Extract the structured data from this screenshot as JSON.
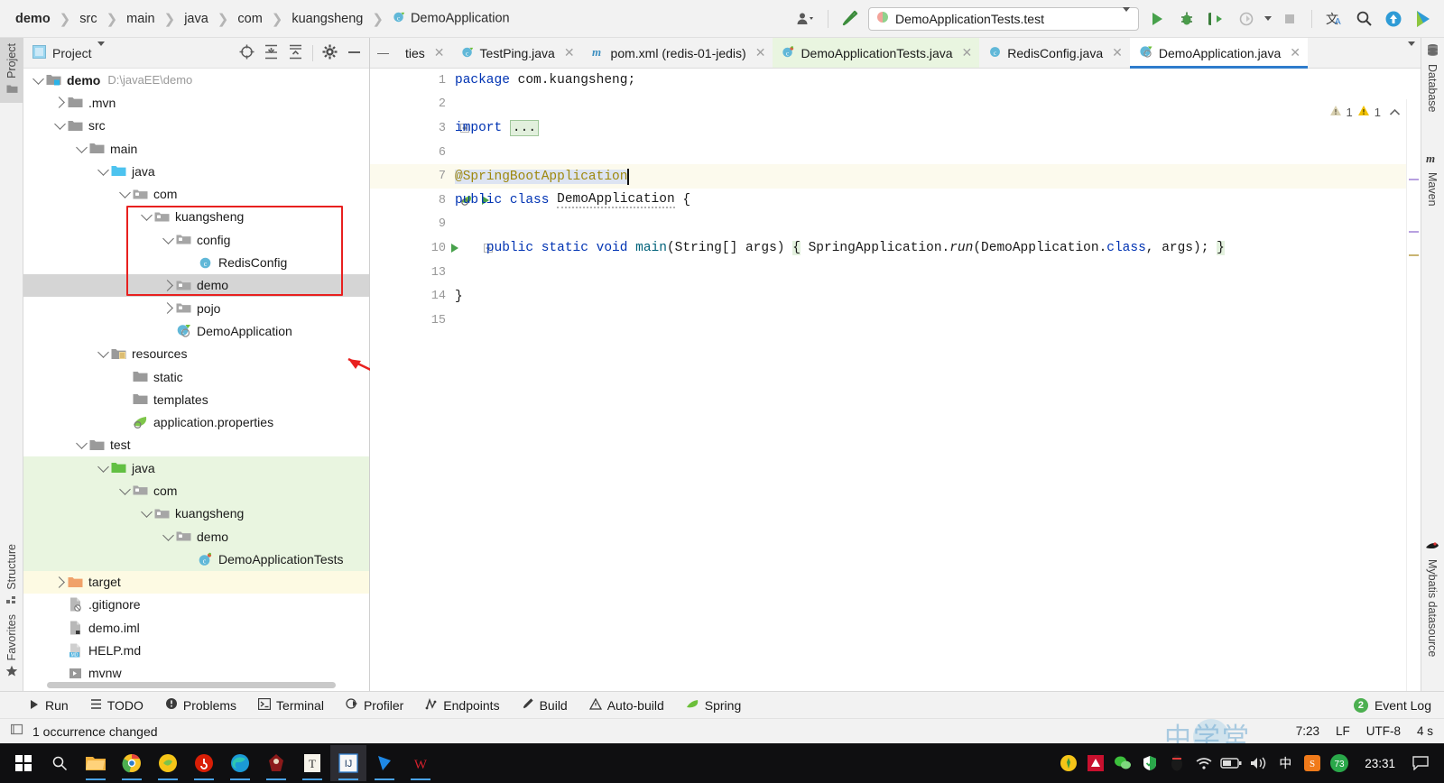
{
  "window": {
    "app": "IntelliJ IDEA",
    "breadcrumb": [
      "demo",
      "src",
      "main",
      "java",
      "com",
      "kuangsheng",
      "DemoApplication"
    ],
    "run_config": "DemoApplicationTests.test"
  },
  "toolbar": {
    "icons": [
      {
        "name": "user-settings-icon",
        "glyph": "👤"
      },
      {
        "name": "build-hammer-icon",
        "glyph": "⚒"
      },
      {
        "name": "run-icon",
        "glyph": "▶"
      },
      {
        "name": "debug-icon",
        "glyph": "🐞"
      },
      {
        "name": "run-with-coverage-icon",
        "glyph": "▶"
      },
      {
        "name": "profiler-icon",
        "glyph": "◎"
      },
      {
        "name": "stop-icon",
        "glyph": "■"
      },
      {
        "name": "translate-icon",
        "glyph": "文A"
      },
      {
        "name": "search-everywhere-icon",
        "glyph": "🔍"
      },
      {
        "name": "update-project-icon",
        "glyph": "↑"
      },
      {
        "name": "ide-feature-icon",
        "glyph": "◖"
      }
    ]
  },
  "left_strip": {
    "tabs": [
      {
        "label": "Project",
        "icon": "folder-icon",
        "active": true
      },
      {
        "label": "Structure",
        "icon": "structure-icon",
        "active": false
      },
      {
        "label": "Favorites",
        "icon": "star-icon",
        "active": false
      }
    ]
  },
  "right_strip": {
    "tabs": [
      {
        "label": "Database",
        "icon": "database-icon"
      },
      {
        "label": "Maven",
        "icon": "maven-m-icon"
      },
      {
        "label": "Mybatis datasource",
        "icon": "mybatis-bird-icon"
      }
    ]
  },
  "project_panel": {
    "title": "Project",
    "header_icons": [
      "target-scope-icon",
      "expand-all-icon",
      "collapse-all-icon",
      "settings-gear-icon",
      "hide-minus-icon"
    ],
    "tree": [
      {
        "label": "demo",
        "path": "D:\\javaEE\\demo",
        "depth": 0,
        "twist": "down",
        "icon": "module-folder-icon",
        "bold": true,
        "row_state": "none"
      },
      {
        "label": ".mvn",
        "path": "",
        "depth": 1,
        "twist": "right",
        "icon": "folder-icon",
        "bold": false,
        "row_state": "none"
      },
      {
        "label": "src",
        "path": "",
        "depth": 1,
        "twist": "down",
        "icon": "folder-icon",
        "bold": false,
        "row_state": "none"
      },
      {
        "label": "main",
        "path": "",
        "depth": 2,
        "twist": "down",
        "icon": "folder-icon",
        "bold": false,
        "row_state": "none"
      },
      {
        "label": "java",
        "path": "",
        "depth": 3,
        "twist": "down",
        "icon": "source-root-blue-icon",
        "bold": false,
        "row_state": "none"
      },
      {
        "label": "com",
        "path": "",
        "depth": 4,
        "twist": "down",
        "icon": "package-icon",
        "bold": false,
        "row_state": "none"
      },
      {
        "label": "kuangsheng",
        "path": "",
        "depth": 5,
        "twist": "down",
        "icon": "package-icon",
        "bold": false,
        "row_state": "none"
      },
      {
        "label": "config",
        "path": "",
        "depth": 6,
        "twist": "down",
        "icon": "package-icon",
        "bold": false,
        "row_state": "none"
      },
      {
        "label": "RedisConfig",
        "path": "",
        "depth": 7,
        "twist": "none",
        "icon": "java-class-icon",
        "bold": false,
        "row_state": "none"
      },
      {
        "label": "demo",
        "path": "",
        "depth": 6,
        "twist": "right",
        "icon": "package-icon",
        "bold": false,
        "row_state": "grey"
      },
      {
        "label": "pojo",
        "path": "",
        "depth": 6,
        "twist": "right",
        "icon": "package-icon",
        "bold": false,
        "row_state": "none"
      },
      {
        "label": "DemoApplication",
        "path": "",
        "depth": 6,
        "twist": "none",
        "icon": "spring-class-icon",
        "bold": false,
        "row_state": "none"
      },
      {
        "label": "resources",
        "path": "",
        "depth": 3,
        "twist": "down",
        "icon": "resource-root-icon",
        "bold": false,
        "row_state": "none"
      },
      {
        "label": "static",
        "path": "",
        "depth": 4,
        "twist": "none",
        "icon": "folder-icon",
        "bold": false,
        "row_state": "none"
      },
      {
        "label": "templates",
        "path": "",
        "depth": 4,
        "twist": "none",
        "icon": "folder-icon",
        "bold": false,
        "row_state": "none"
      },
      {
        "label": "application.properties",
        "path": "",
        "depth": 4,
        "twist": "none",
        "icon": "spring-properties-icon",
        "bold": false,
        "row_state": "none"
      },
      {
        "label": "test",
        "path": "",
        "depth": 2,
        "twist": "down",
        "icon": "folder-icon",
        "bold": false,
        "row_state": "none"
      },
      {
        "label": "java",
        "path": "",
        "depth": 3,
        "twist": "down",
        "icon": "test-root-green-icon",
        "bold": false,
        "row_state": "green"
      },
      {
        "label": "com",
        "path": "",
        "depth": 4,
        "twist": "down",
        "icon": "package-icon",
        "bold": false,
        "row_state": "green"
      },
      {
        "label": "kuangsheng",
        "path": "",
        "depth": 5,
        "twist": "down",
        "icon": "package-icon",
        "bold": false,
        "row_state": "green"
      },
      {
        "label": "demo",
        "path": "",
        "depth": 6,
        "twist": "down",
        "icon": "package-icon",
        "bold": false,
        "row_state": "green"
      },
      {
        "label": "DemoApplicationTests",
        "path": "",
        "depth": 7,
        "twist": "none",
        "icon": "java-test-class-icon",
        "bold": false,
        "row_state": "green"
      },
      {
        "label": "target",
        "path": "",
        "depth": 1,
        "twist": "right",
        "icon": "excluded-folder-icon",
        "bold": false,
        "row_state": "yellow"
      },
      {
        "label": ".gitignore",
        "path": "",
        "depth": 1,
        "twist": "none",
        "icon": "gitignore-file-icon",
        "bold": false,
        "row_state": "none"
      },
      {
        "label": "demo.iml",
        "path": "",
        "depth": 1,
        "twist": "none",
        "icon": "iml-file-icon",
        "bold": false,
        "row_state": "none"
      },
      {
        "label": "HELP.md",
        "path": "",
        "depth": 1,
        "twist": "none",
        "icon": "markdown-file-icon",
        "bold": false,
        "row_state": "none"
      },
      {
        "label": "mvnw",
        "path": "",
        "depth": 1,
        "twist": "none",
        "icon": "script-file-icon",
        "bold": false,
        "row_state": "none"
      }
    ],
    "annotation_color": "#e8201f"
  },
  "editor": {
    "tabs": [
      {
        "label": "ties",
        "icon": "truncated-tab",
        "state": "normal"
      },
      {
        "label": "TestPing.java",
        "icon": "java-class-icon",
        "state": "normal"
      },
      {
        "label": "pom.xml (redis-01-jedis)",
        "icon": "maven-m-icon",
        "state": "normal"
      },
      {
        "label": "DemoApplicationTests.java",
        "icon": "java-test-class-icon",
        "state": "green"
      },
      {
        "label": "RedisConfig.java",
        "icon": "java-class-icon",
        "state": "normal"
      },
      {
        "label": "DemoApplication.java",
        "icon": "spring-class-icon",
        "state": "active"
      }
    ],
    "line_numbers": [
      "1",
      "2",
      "3",
      "6",
      "7",
      "8",
      "9",
      "10",
      "13",
      "14",
      "15"
    ],
    "code_lines": [
      {
        "n": "1",
        "text": "package com.kuangsheng;"
      },
      {
        "n": "2",
        "text": ""
      },
      {
        "n": "3",
        "text": "import ..."
      },
      {
        "n": "6",
        "text": ""
      },
      {
        "n": "7",
        "text": "@SpringBootApplication"
      },
      {
        "n": "8",
        "text": "public class DemoApplication {"
      },
      {
        "n": "9",
        "text": ""
      },
      {
        "n": "10",
        "text": "    public static void main(String[] args) { SpringApplication.run(DemoApplication.class, args); }"
      },
      {
        "n": "13",
        "text": ""
      },
      {
        "n": "14",
        "text": "}"
      },
      {
        "n": "15",
        "text": ""
      }
    ],
    "inspections": {
      "weak_warnings": "1",
      "warnings": "1"
    },
    "caret_line": "7"
  },
  "bottom_bar": {
    "buttons": [
      {
        "label": "Run",
        "icon": "run-icon"
      },
      {
        "label": "TODO",
        "icon": "todo-list-icon"
      },
      {
        "label": "Problems",
        "icon": "problems-icon"
      },
      {
        "label": "Terminal",
        "icon": "terminal-icon"
      },
      {
        "label": "Profiler",
        "icon": "profiler-icon"
      },
      {
        "label": "Endpoints",
        "icon": "endpoints-icon"
      },
      {
        "label": "Build",
        "icon": "build-hammer-icon"
      },
      {
        "label": "Auto-build",
        "icon": "warning-triangle-icon"
      },
      {
        "label": "Spring",
        "icon": "spring-leaf-icon"
      }
    ],
    "event_log": {
      "label": "Event Log",
      "count": "2"
    }
  },
  "status_bar": {
    "message": "1 occurrence changed",
    "caret_position": "7:23",
    "line_separator": "LF",
    "encoding": "UTF-8",
    "indent": "4 s"
  },
  "taskbar": {
    "apps": [
      {
        "name": "start-button",
        "glyph": "⊞"
      },
      {
        "name": "search-icon",
        "glyph": "🔍"
      },
      {
        "name": "file-explorer-icon",
        "glyph": "🗂"
      },
      {
        "name": "chrome-icon",
        "glyph": "◉"
      },
      {
        "name": "sougou-browser-icon",
        "glyph": "●"
      },
      {
        "name": "netease-music-icon",
        "glyph": "♫"
      },
      {
        "name": "edge-icon",
        "glyph": "◑"
      },
      {
        "name": "tomcat-icon",
        "glyph": "◆"
      },
      {
        "name": "typora-icon",
        "glyph": "T"
      },
      {
        "name": "intellij-idea-icon",
        "glyph": "IJ"
      },
      {
        "name": "navicat-icon",
        "glyph": "◤"
      },
      {
        "name": "wps-icon",
        "glyph": "W"
      }
    ],
    "tray": [
      {
        "name": "tray-plugin-icon",
        "glyph": "✦"
      },
      {
        "name": "tray-amd-icon",
        "glyph": "◧"
      },
      {
        "name": "wechat-icon",
        "glyph": "◕"
      },
      {
        "name": "security-shield-icon",
        "glyph": "✔"
      },
      {
        "name": "qq-penguin-icon",
        "glyph": "●"
      },
      {
        "name": "wifi-icon",
        "glyph": "◠"
      },
      {
        "name": "battery-icon",
        "glyph": "▭"
      },
      {
        "name": "volume-icon",
        "glyph": "🔊"
      },
      {
        "name": "ime-chinese-icon",
        "glyph": "中"
      },
      {
        "name": "sogou-input-icon",
        "glyph": "S"
      },
      {
        "name": "temperature-badge",
        "glyph": "73"
      }
    ],
    "clock": "23:31",
    "notification_icon": "notification-bubble-icon"
  }
}
